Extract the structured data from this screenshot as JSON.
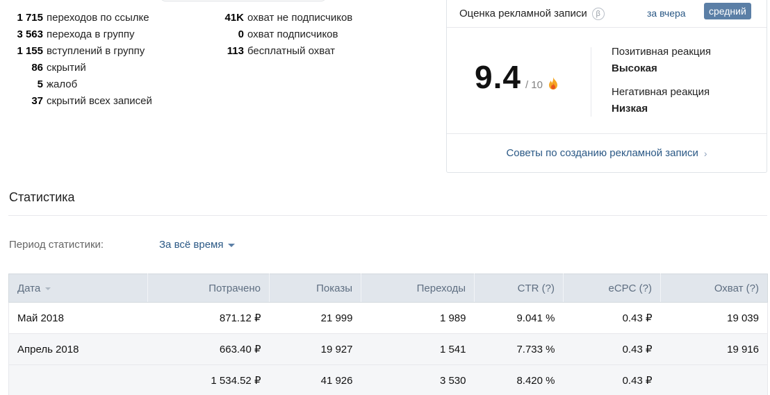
{
  "metrics": {
    "left": [
      {
        "value": "1 715",
        "label": "переходов по ссылке"
      },
      {
        "value": "3 563",
        "label": "перехода в группу"
      },
      {
        "value": "1 155",
        "label": "вступлений в группу"
      },
      {
        "value": "86",
        "label": "скрытий"
      },
      {
        "value": "5",
        "label": "жалоб"
      },
      {
        "value": "37",
        "label": "скрытий всех записей"
      }
    ],
    "right": [
      {
        "value": "41K",
        "label": "охват не подписчиков"
      },
      {
        "value": "0",
        "label": "охват подписчиков"
      },
      {
        "value": "113",
        "label": "бесплатный охват"
      }
    ]
  },
  "rating": {
    "title": "Оценка рекламной записи",
    "beta": "β",
    "tab_yesterday": "за вчера",
    "tab_average": "средний",
    "score": "9.4",
    "score_of": "/ 10",
    "positive_label": "Позитивная реакция",
    "positive_value": "Высокая",
    "negative_label": "Негативная реакция",
    "negative_value": "Низкая",
    "tips_link": "Советы по созданию рекламной записи",
    "chevron": "›"
  },
  "stats": {
    "title": "Статистика",
    "period_label": "Период статистики:",
    "period_value": "За всё время",
    "columns": [
      "Дата",
      "Потрачено",
      "Показы",
      "Переходы",
      "CTR (?)",
      "eCPC (?)",
      "Охват (?)"
    ],
    "rows": [
      [
        "Май 2018",
        "871.12 ₽",
        "21 999",
        "1 989",
        "9.041 %",
        "0.43 ₽",
        "19 039"
      ],
      [
        "Апрель 2018",
        "663.40 ₽",
        "19 927",
        "1 541",
        "7.733 %",
        "0.43 ₽",
        "19 916"
      ],
      [
        "",
        "1 534.52 ₽",
        "41 926",
        "3 530",
        "8.420 %",
        "0.43 ₽",
        ""
      ]
    ]
  },
  "colors": {
    "link": "#2a5885",
    "accent_button": "#5b7fa6",
    "table_header_bg": "#e1e6ec",
    "fire_outer": "#f5a623",
    "fire_inner": "#e8551c"
  }
}
